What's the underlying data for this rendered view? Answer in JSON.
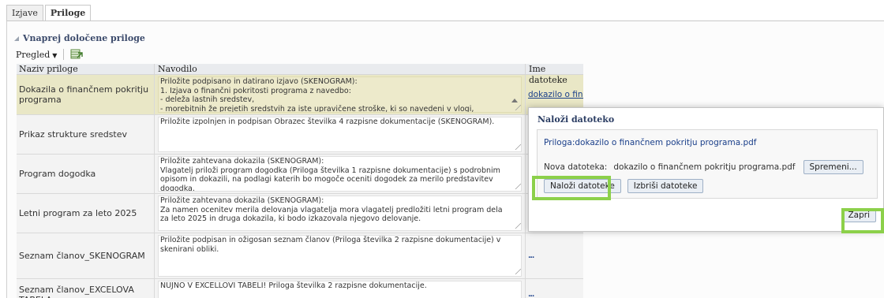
{
  "tabs": [
    {
      "label": "Izjave",
      "active": false
    },
    {
      "label": "Priloge",
      "active": true
    }
  ],
  "section": {
    "title": "Vnaprej določene priloge",
    "toolbar": {
      "view_label": "Pregled"
    }
  },
  "table": {
    "headers": [
      "Naziv priloge",
      "Navodilo",
      "Ime datoteke"
    ],
    "rows": [
      {
        "name": "Dokazila o finančnem pokritju programa",
        "instruction": "Priložite podpisano in datirano izjavo (SKENOGRAM):\n1. Izjava o finančni pokritosti programa z navedbo:\n- deleža lastnih sredstev,\n- morebitnih že prejetih sredstvih za iste upravičene stroške, ki so navedeni v vlogi,",
        "file": "dokazilo o finančn...",
        "selected": true
      },
      {
        "name": "Prikaz strukture sredstev",
        "instruction": "Priložite izpolnjen in podpisan Obrazec številka 4 razpisne dokumentacije (SKENOGRAM).",
        "file": "...",
        "selected": false
      },
      {
        "name": "Program dogodka",
        "instruction": "Priložite zahtevana dokazila (SKENOGRAM):\nVlagatelj priloži program dogodka (Priloga številka 1 razpisne dokumentacije) s podrobnim opisom in dokazili, na podlagi katerih bo mogoče oceniti dogodek za merilo predstavitev dogodka.",
        "file": "...",
        "selected": false
      },
      {
        "name": "Letni program za leto 2025",
        "instruction": "Priložite zahtevana dokazila (SKENOGRAM):\nZa namen ocenitev merila delovanja vlagatelja mora vlagatelj predložiti letni program dela za leto 2025 in druga dokazila, ki bodo izkazovala njegovo delovanje.",
        "file": "...",
        "selected": false
      },
      {
        "name": "Seznam članov_SKENOGRAM",
        "instruction": "Priložite podpisan in ožigosan seznam članov (Priloga številka 2 razpisne dokumentacije) v skenirani obliki.",
        "file": "...",
        "selected": false
      },
      {
        "name": "Seznam članov_EXCELOVA TABELA",
        "instruction": "NUJNO V EXCELLOVI TABELI! Priloga številka 2 razpisne dokumentacije.",
        "file": "...",
        "selected": false
      }
    ]
  },
  "dialog": {
    "title": "Naloži datoteko",
    "priloga": "Priloga:dokazilo o finančnem pokritju programa.pdf",
    "nova_label": "Nova datoteka:",
    "nova_value": "dokazilo o finančnem pokritju programa.pdf",
    "spremeni_label": "Spremeni...",
    "nalozi_label": "Naloži datoteke",
    "izbrisi_label": "Izbriši datoteke",
    "zapri_label": "Zapri"
  },
  "colors": {
    "highlight": "#8cd04a",
    "link": "#1a3f8a",
    "selected_row": "#e9e7c6"
  }
}
